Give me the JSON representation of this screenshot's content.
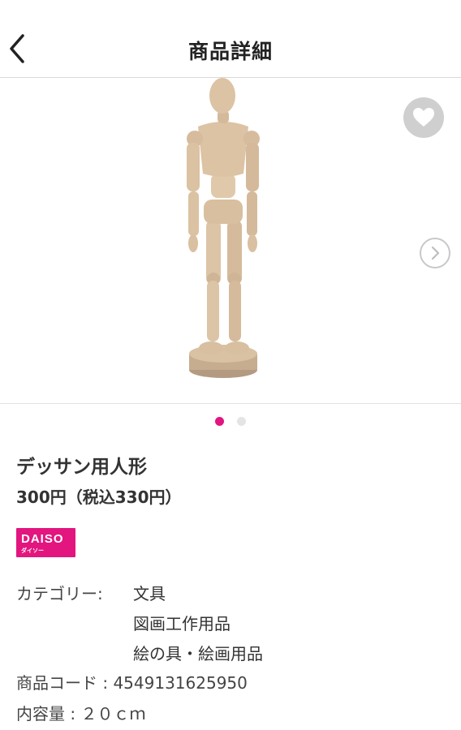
{
  "header": {
    "title": "商品詳細",
    "back_icon": "chevron-left-icon"
  },
  "gallery": {
    "image_alt": "デッサン用人形",
    "favorite_icon": "heart-icon",
    "next_icon": "chevron-right-icon",
    "total_pages": 2,
    "current_page": 1
  },
  "product": {
    "name": "デッサン用人形",
    "price": "300円（税込330円）",
    "brand": {
      "logo_text": "DAISO",
      "logo_sub": "ダイソー",
      "color": "#e3157f"
    },
    "category_label": "カテゴリー:",
    "categories": [
      "文具",
      "図画工作用品",
      "絵の具・絵画用品"
    ],
    "code_label": "商品コード : ",
    "code_value": "4549131625950",
    "content_label": "内容量 : ",
    "content_value": "２０ｃｍ"
  },
  "colors": {
    "accent": "#e3157f",
    "dot_inactive": "#e4e4e4",
    "favorite_bg": "#cfcfcf"
  }
}
